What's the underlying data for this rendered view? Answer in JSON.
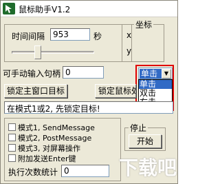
{
  "window": {
    "title": "鼠标助手V1.2"
  },
  "interval": {
    "label": "时间间隔",
    "value": "953",
    "unit": "秒"
  },
  "slider": {
    "level_percent": 30
  },
  "coords": {
    "legend": "坐标",
    "x_label": "x",
    "y_label": "y"
  },
  "handle": {
    "label": "可手动输入句柄",
    "value": "0"
  },
  "click_type": {
    "selected": "单击",
    "options": [
      "单击",
      "双击",
      "右击"
    ],
    "highlight_color": "#e00000"
  },
  "buttons": {
    "lock_main_window": "锁定主窗口目标",
    "lock_mouse": "锁定鼠标处"
  },
  "status_message": "在模式1或2, 先锁定目标!",
  "modes": [
    {
      "label": "模式1, SendMessage"
    },
    {
      "label": "模式2, PostMessage"
    },
    {
      "label": "模式3, 对屏幕操作"
    },
    {
      "label": "附加发送Enter键"
    }
  ],
  "exec_count": {
    "label": "执行次数统计",
    "value": "0"
  },
  "control": {
    "stop_label": "停止",
    "start_label": "开始"
  },
  "icons": {
    "app": "app-logo-icon",
    "arrow": "chevron-down-icon"
  },
  "colors": {
    "selection": "#316ac5",
    "window_bg": "#ece9d8"
  }
}
